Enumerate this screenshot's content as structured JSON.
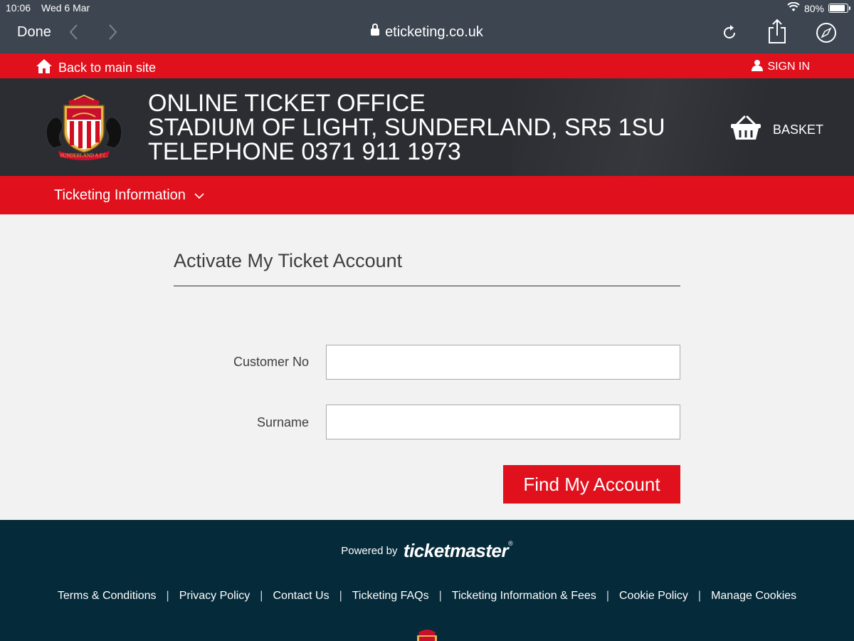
{
  "status_bar": {
    "time": "10:06",
    "date": "Wed 6 Mar",
    "battery": "80%",
    "battery_level": 0.8
  },
  "browser": {
    "done_label": "Done",
    "url": "eticketing.co.uk"
  },
  "top_strip": {
    "back_label": "Back to main site",
    "sign_in_label": "SIGN IN"
  },
  "header": {
    "line1": "ONLINE TICKET OFFICE",
    "line2": "STADIUM OF LIGHT, SUNDERLAND, SR5 1SU",
    "line3": "TELEPHONE 0371 911 1973",
    "basket_label": "BASKET",
    "crest_text": "SUNDERLAND A.F.C."
  },
  "menu": {
    "ticketing_info_label": "Ticketing Information"
  },
  "form": {
    "title": "Activate My Ticket Account",
    "customer_no_label": "Customer No",
    "customer_no_value": "",
    "surname_label": "Surname",
    "surname_value": "",
    "submit_label": "Find My Account"
  },
  "footer": {
    "powered_by": "Powered by",
    "brand": "ticketmaster",
    "brand_mark": "®",
    "links": [
      "Terms & Conditions",
      "Privacy Policy",
      "Contact Us",
      "Ticketing FAQs",
      "Ticketing Information & Fees",
      "Cookie Policy",
      "Manage Cookies"
    ]
  },
  "colors": {
    "brand_red": "#e0101c",
    "header_dark": "#2b2d33",
    "footer_navy": "#052a3a",
    "safari_bar": "#3c4550"
  }
}
